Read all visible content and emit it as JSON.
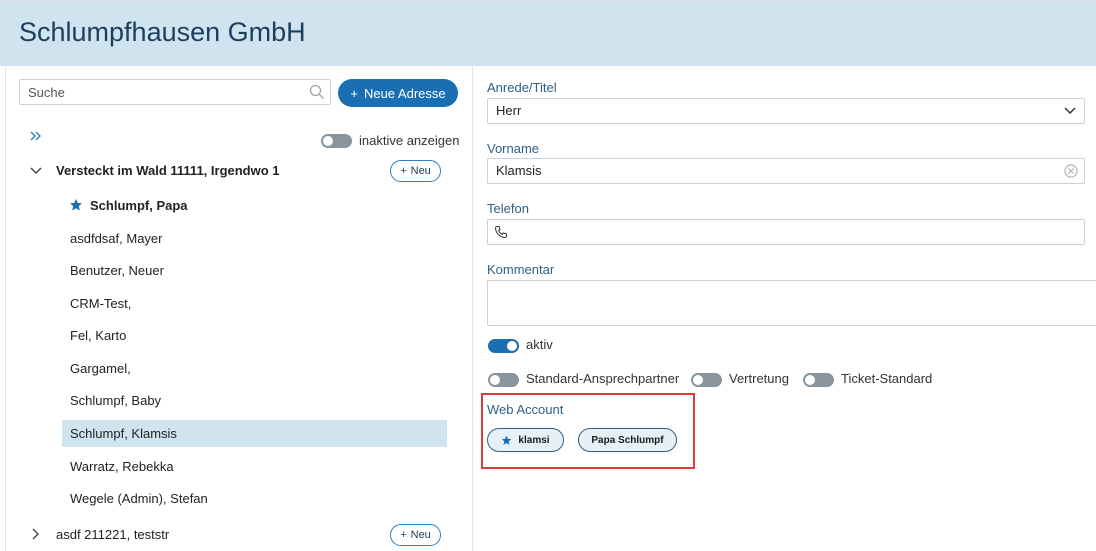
{
  "header": {
    "title": "Schlumpfhausen GmbH"
  },
  "left": {
    "search_placeholder": "Suche",
    "new_address_label": "Neue Adresse",
    "show_inactive_label": "inaktive anzeigen",
    "groups": [
      {
        "title": "Versteckt im Wald 11111, Irgendwo 1",
        "new_label": "Neu",
        "expanded": true,
        "items": [
          {
            "label": "Schlumpf, Papa",
            "starred": true
          },
          {
            "label": "asdfdsaf, Mayer"
          },
          {
            "label": "Benutzer, Neuer"
          },
          {
            "label": "CRM-Test,"
          },
          {
            "label": "Fel, Karto"
          },
          {
            "label": "Gargamel,"
          },
          {
            "label": "Schlumpf, Baby"
          },
          {
            "label": "Schlumpf, Klamsis",
            "selected": true
          },
          {
            "label": "Warratz, Rebekka"
          },
          {
            "label": "Wegele (Admin), Stefan"
          }
        ]
      },
      {
        "title": "asdf 211221, teststr",
        "new_label": "Neu",
        "expanded": false
      }
    ]
  },
  "form": {
    "salutation_label": "Anrede/Titel",
    "salutation_value": "Herr",
    "firstname_label": "Vorname",
    "firstname_value": "Klamsis",
    "phone_label": "Telefon",
    "phone_value": "",
    "comment_label": "Kommentar",
    "comment_value": "",
    "active_label": "aktiv",
    "toggles": {
      "standard_contact": "Standard-Ansprechpartner",
      "substitution": "Vertretung",
      "ticket_standard": "Ticket-Standard"
    },
    "web_account_label": "Web Account",
    "web_accounts": [
      {
        "label": "klamsi",
        "starred": true
      },
      {
        "label": "Papa Schlumpf",
        "starred": false
      }
    ]
  },
  "colors": {
    "accent": "#1a6fb3",
    "header_bg": "#cfe4ef",
    "highlight": "#e03b3b",
    "selected_bg": "#cfe4ef"
  }
}
